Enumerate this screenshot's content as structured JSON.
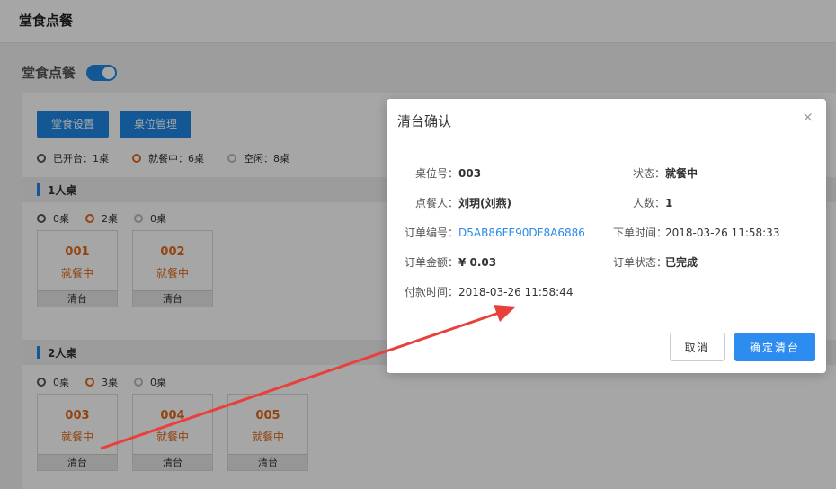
{
  "topbar": {
    "title": "堂食点餐"
  },
  "page": {
    "heading": "堂食点餐",
    "toggle_on": true
  },
  "toolbar": {
    "settings_label": "堂食设置",
    "tables_label": "桌位管理"
  },
  "summary": [
    {
      "label": "已开台：1桌",
      "kind": "open"
    },
    {
      "label": "就餐中：6桌",
      "kind": "dining"
    },
    {
      "label": "空闲：8桌",
      "kind": "idle"
    }
  ],
  "sections": [
    {
      "title": "1人桌",
      "legend": [
        "0桌",
        "2桌",
        "0桌"
      ],
      "tables": [
        {
          "no": "001",
          "state": "就餐中",
          "action": "清台"
        },
        {
          "no": "002",
          "state": "就餐中",
          "action": "清台"
        }
      ]
    },
    {
      "title": "2人桌",
      "legend": [
        "0桌",
        "3桌",
        "0桌"
      ],
      "tables": [
        {
          "no": "003",
          "state": "就餐中",
          "action": "清台"
        },
        {
          "no": "004",
          "state": "就餐中",
          "action": "清台"
        },
        {
          "no": "005",
          "state": "就餐中",
          "action": "清台"
        }
      ]
    }
  ],
  "modal": {
    "title": "清台确认",
    "close_icon": "×",
    "fields": {
      "table_no_label": "桌位号：",
      "table_no": "003",
      "status_label": "状态：",
      "status": "就餐中",
      "orderer_label": "点餐人：",
      "orderer": "刘玥(刘燕)",
      "people_label": "人数：",
      "people": "1",
      "order_no_label": "订单编号：",
      "order_no": "D5AB86FE90DF8A6886",
      "order_time_label": "下单时间：",
      "order_time": "2018-03-26 11:58:33",
      "amount_label": "订单金额：",
      "amount": "¥ 0.03",
      "order_status_label": "订单状态：",
      "order_status": "已完成",
      "pay_time_label": "付款时间：",
      "pay_time": "2018-03-26 11:58:44"
    },
    "cancel_label": "取消",
    "confirm_label": "确定清台"
  },
  "colors": {
    "primary": "#1e88e5",
    "dining": "#e06a1b",
    "arrow": "#e8413c"
  }
}
